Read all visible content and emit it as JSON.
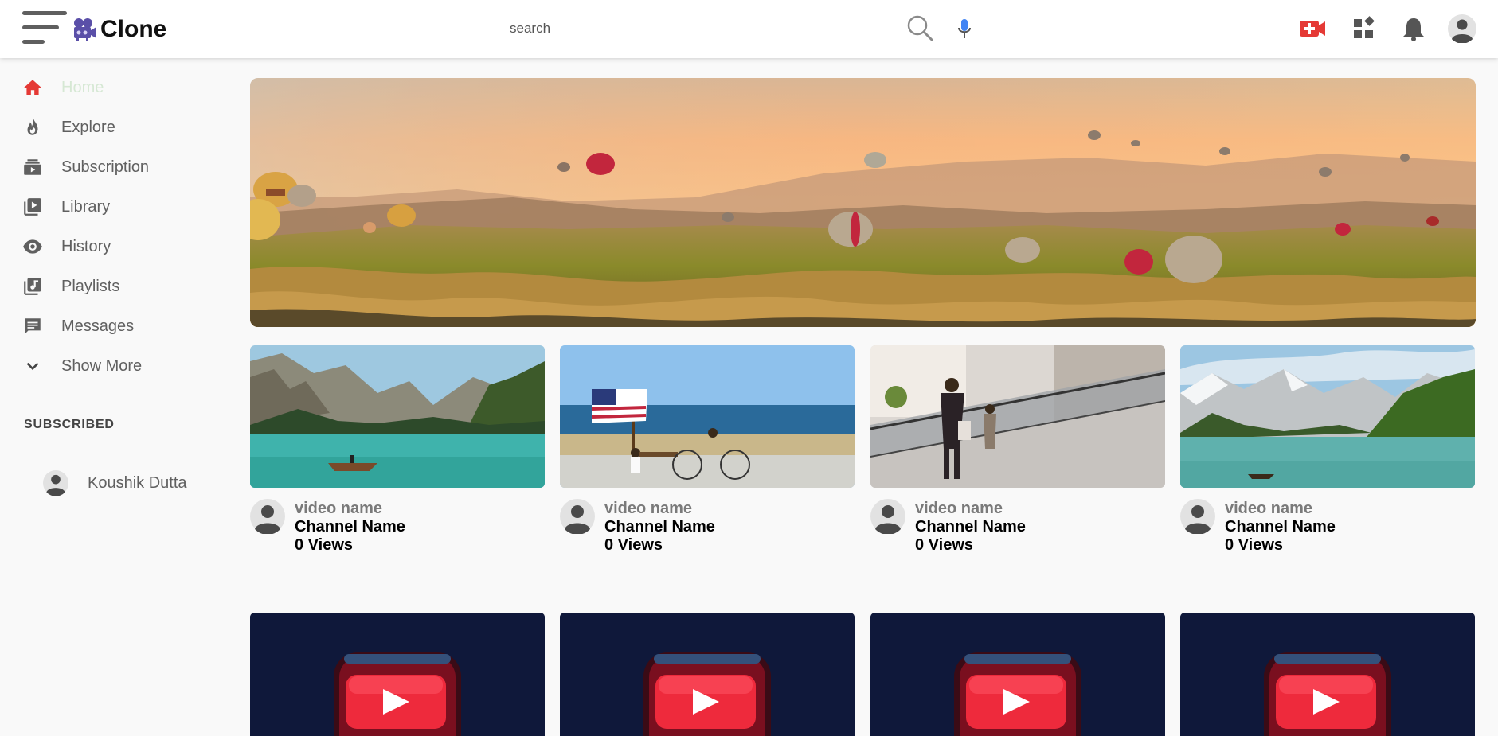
{
  "header": {
    "logo_text": "Clone",
    "search_placeholder": "search"
  },
  "colors": {
    "accent": "#e53935",
    "sidebar_active": "#d6e8d4",
    "divider": "#d0413a",
    "thumb_dark": "#0f183a"
  },
  "sidebar": {
    "items": [
      {
        "label": "Home",
        "icon": "home-icon"
      },
      {
        "label": "Explore",
        "icon": "flame-icon"
      },
      {
        "label": "Subscription",
        "icon": "subscriptions-icon"
      },
      {
        "label": "Library",
        "icon": "library-icon"
      },
      {
        "label": "History",
        "icon": "eye-icon"
      },
      {
        "label": "Playlists",
        "icon": "playlist-icon"
      },
      {
        "label": "Messages",
        "icon": "chat-icon"
      },
      {
        "label": "Show More",
        "icon": "chevron-down-icon"
      }
    ],
    "subscribed_heading": "SUBSCRIBED",
    "subscriptions": [
      {
        "name": "Koushik Dutta"
      }
    ]
  },
  "videos": [
    {
      "title": "video name",
      "channel": "Channel Name",
      "views": "0 Views",
      "thumb": "lake-boat"
    },
    {
      "title": "video name",
      "channel": "Channel Name",
      "views": "0 Views",
      "thumb": "beach-flag"
    },
    {
      "title": "video name",
      "channel": "Channel Name",
      "views": "0 Views",
      "thumb": "mall-escalator"
    },
    {
      "title": "video name",
      "channel": "Channel Name",
      "views": "0 Views",
      "thumb": "mountain-lake"
    }
  ],
  "placeholder_videos": [
    {
      "thumb": "play-logo"
    },
    {
      "thumb": "play-logo"
    },
    {
      "thumb": "play-logo"
    },
    {
      "thumb": "play-logo"
    }
  ]
}
